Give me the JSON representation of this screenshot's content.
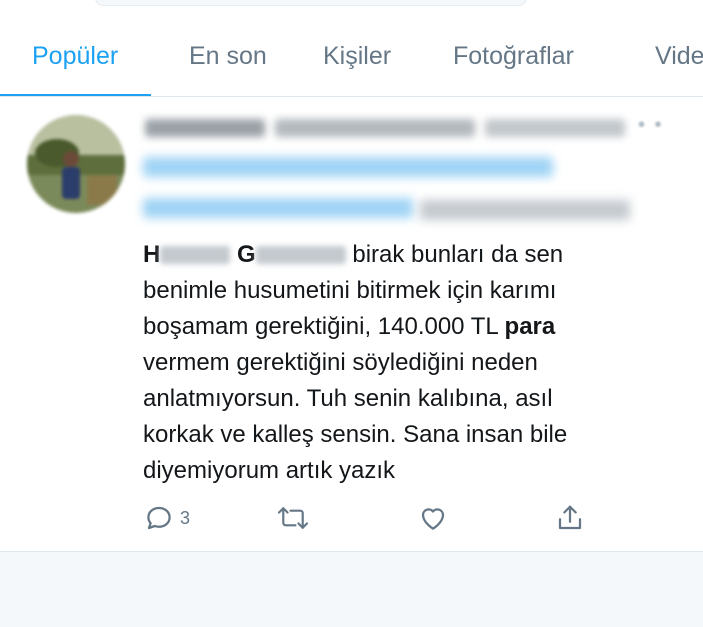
{
  "tabs": [
    {
      "label": "Popüler",
      "active": true
    },
    {
      "label": "En son",
      "active": false
    },
    {
      "label": "Kişiler",
      "active": false
    },
    {
      "label": "Fotoğraflar",
      "active": false
    },
    {
      "label": "Vide",
      "active": false
    }
  ],
  "tweet": {
    "name_visible_initial_1": "H",
    "name_visible_initial_2": "G",
    "text_lines": [
      " birak bunları da sen",
      "benimle husumetini bitirmek için karımı",
      "boşamam gerektiğini,  140.000 TL ",
      "vermem gerektiğini söylediğini neden",
      "anlatmıyorsun. Tuh senin kalıbına, asıl",
      "korkak ve kalleş sensin. Sana insan bile",
      "diyemiyorum artık yazık"
    ],
    "bold_word": "para",
    "reply_count": "3"
  },
  "icons": {
    "reply": "reply-icon",
    "retweet": "retweet-icon",
    "like": "heart-icon",
    "share": "share-icon",
    "more": "more-icon"
  },
  "colors": {
    "accent": "#1da1f2",
    "muted": "#657786",
    "text": "#14171a",
    "divider": "#e1e8ed",
    "background": "#f5f8fa"
  }
}
